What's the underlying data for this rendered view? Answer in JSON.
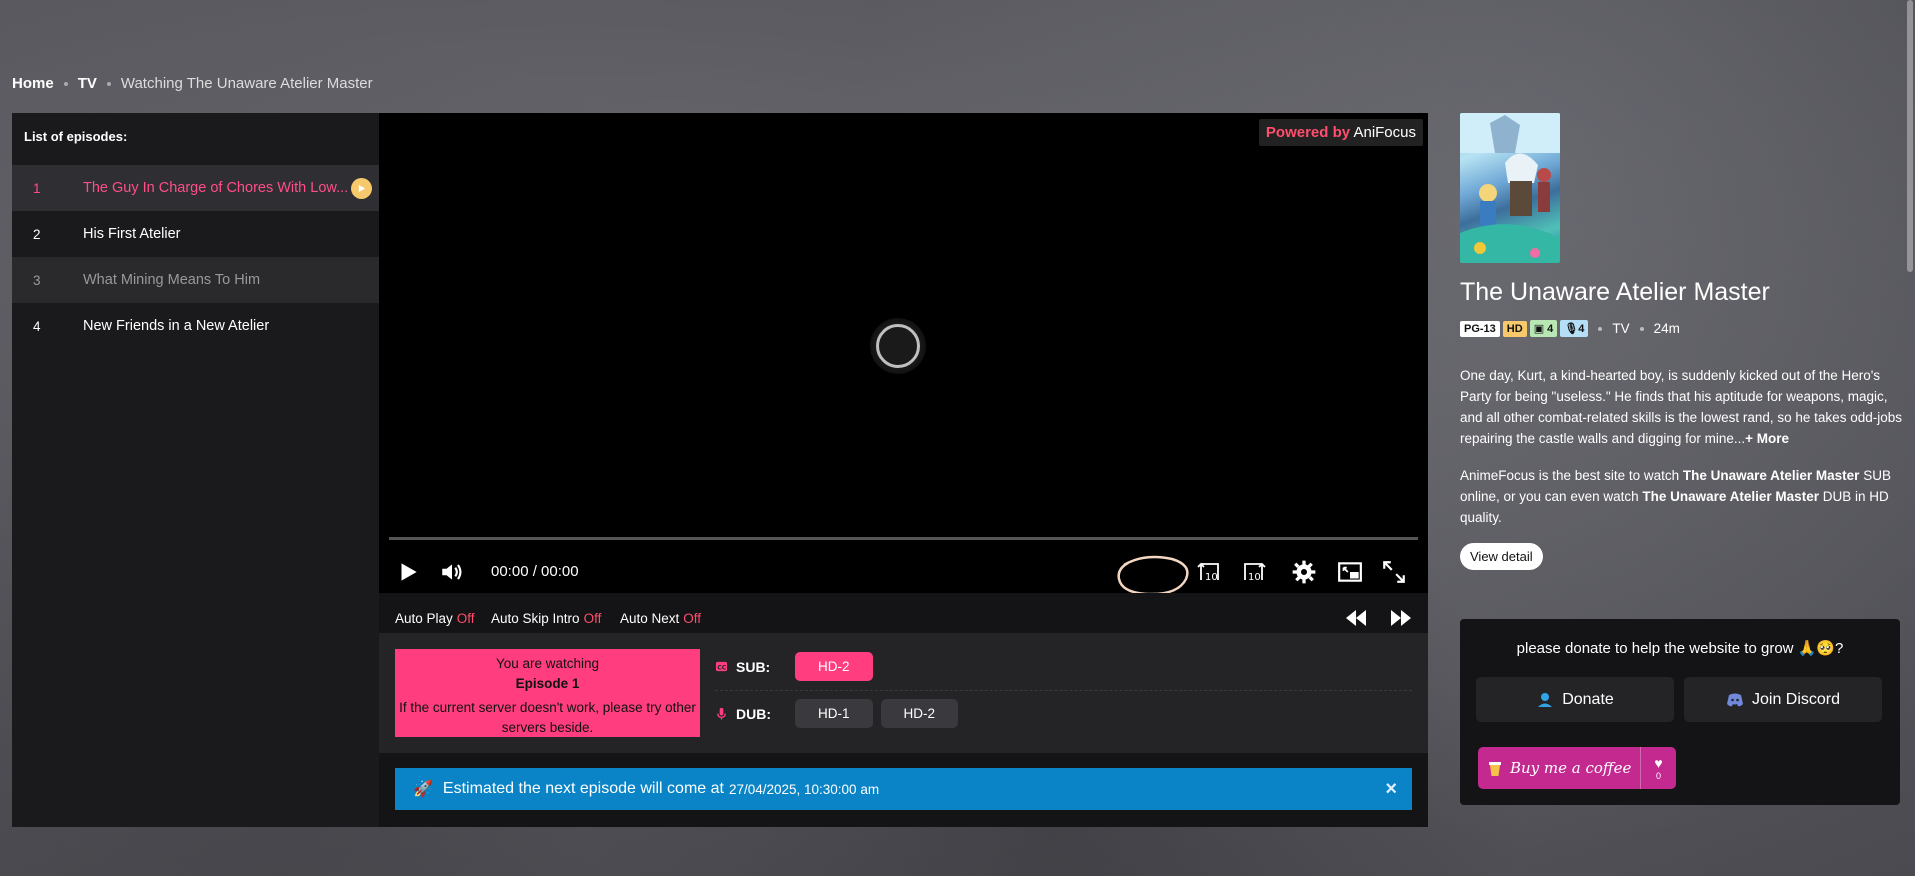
{
  "breadcrumb": {
    "home": "Home",
    "tv": "TV",
    "current": "Watching The Unaware Atelier Master"
  },
  "episodes": {
    "header": "List of episodes:",
    "items": [
      {
        "num": "1",
        "title": "The Guy In Charge of Chores With Low..."
      },
      {
        "num": "2",
        "title": "His First Atelier"
      },
      {
        "num": "3",
        "title": "What Mining Means To Him"
      },
      {
        "num": "4",
        "title": "New Friends in a New Atelier"
      }
    ]
  },
  "player": {
    "powered_prefix": "Powered by",
    "powered_brand": "AniFocus",
    "time": "00:00 / 00:00",
    "rewind_label": "10",
    "forward_label": "10"
  },
  "options": {
    "auto_play": "Auto Play",
    "auto_play_value": "Off",
    "auto_skip": "Auto Skip Intro",
    "auto_skip_value": "Off",
    "auto_next": "Auto Next",
    "auto_next_value": "Off"
  },
  "servers": {
    "watching_line1": "You are watching",
    "watching_episode": "Episode 1",
    "watching_line3": "If the current server doesn't work, please try other servers beside.",
    "sub_label": "SUB:",
    "dub_label": "DUB:",
    "sub": [
      "HD-2"
    ],
    "dub": [
      "HD-1",
      "HD-2"
    ]
  },
  "next": {
    "icon": "🚀",
    "text": "Estimated the next episode will come at",
    "date": "27/04/2025, 10:30:00 am",
    "close": "×"
  },
  "anime": {
    "title": "The Unaware Atelier Master",
    "rating": "PG-13",
    "quality": "HD",
    "sub_count": "4",
    "dub_count": "4",
    "type": "TV",
    "duration": "24m",
    "desc": "One day, Kurt, a kind-hearted boy, is suddenly kicked out of the Hero's Party for being \"useless.\" He finds that his aptitude for weapons, magic, and all other combat-related skills is the lowest rand, so he takes odd-jobs repairing the castle walls and digging for mine...",
    "more": "+ More",
    "site_p1": "AnimeFocus is the best site to watch",
    "site_b1": "The Unaware Atelier Master",
    "site_p2": "SUB online, or you can even watch",
    "site_b2": "The Unaware Atelier Master",
    "site_p3": "DUB in HD quality.",
    "view_detail": "View detail"
  },
  "donate": {
    "text": "please donate to help the website to grow 🙏🥺?",
    "donate_btn": "Donate",
    "discord_btn": "Join Discord",
    "coffee": "Buy me a coffee",
    "coffee_count": "0"
  },
  "colors": {
    "accent": "#ff3d7f",
    "next_bar": "#0a84c6",
    "highlight": "#f7c96b"
  }
}
